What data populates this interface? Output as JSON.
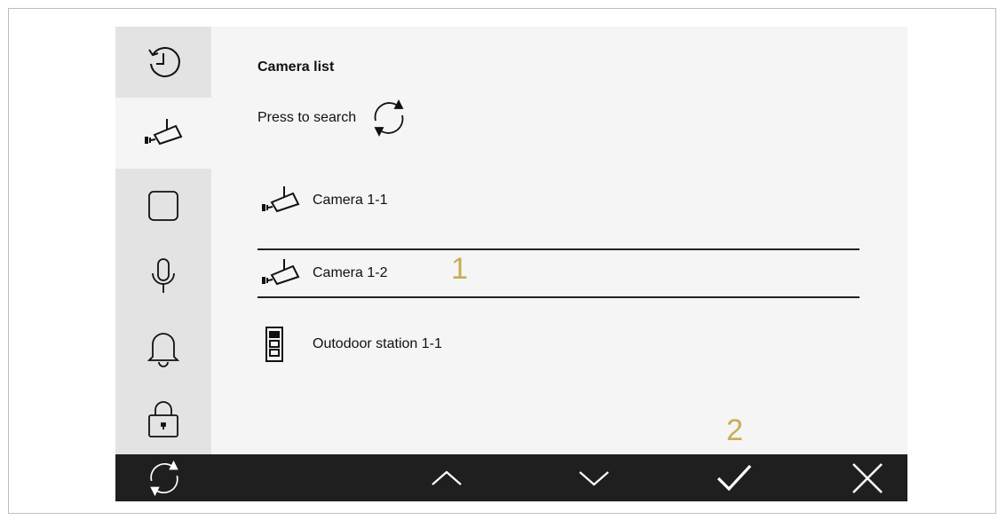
{
  "content": {
    "title": "Camera list",
    "search_label": "Press to search",
    "items": [
      {
        "label": "Camera 1-1",
        "icon": "camera-icon",
        "selected": false
      },
      {
        "label": "Camera 1-2",
        "icon": "camera-icon",
        "selected": true
      },
      {
        "label": "Outodoor station 1-1",
        "icon": "outdoor-station-icon",
        "selected": false
      }
    ]
  },
  "annotations": {
    "one": "1",
    "two": "2"
  },
  "sidebar": {
    "items": [
      {
        "icon": "history-icon",
        "active": false
      },
      {
        "icon": "camera-icon",
        "active": true
      },
      {
        "icon": "square-icon",
        "active": false
      },
      {
        "icon": "microphone-icon",
        "active": false
      },
      {
        "icon": "bell-icon",
        "active": false
      },
      {
        "icon": "lock-icon",
        "active": false
      }
    ]
  },
  "bottom_bar": {
    "buttons": [
      "refresh-icon",
      "chevron-up-icon",
      "chevron-down-icon",
      "check-icon",
      "close-icon"
    ]
  },
  "colors": {
    "annotation": "#c8ad54",
    "bar": "#1f1f1f",
    "sidebar": "#e3e3e3"
  }
}
